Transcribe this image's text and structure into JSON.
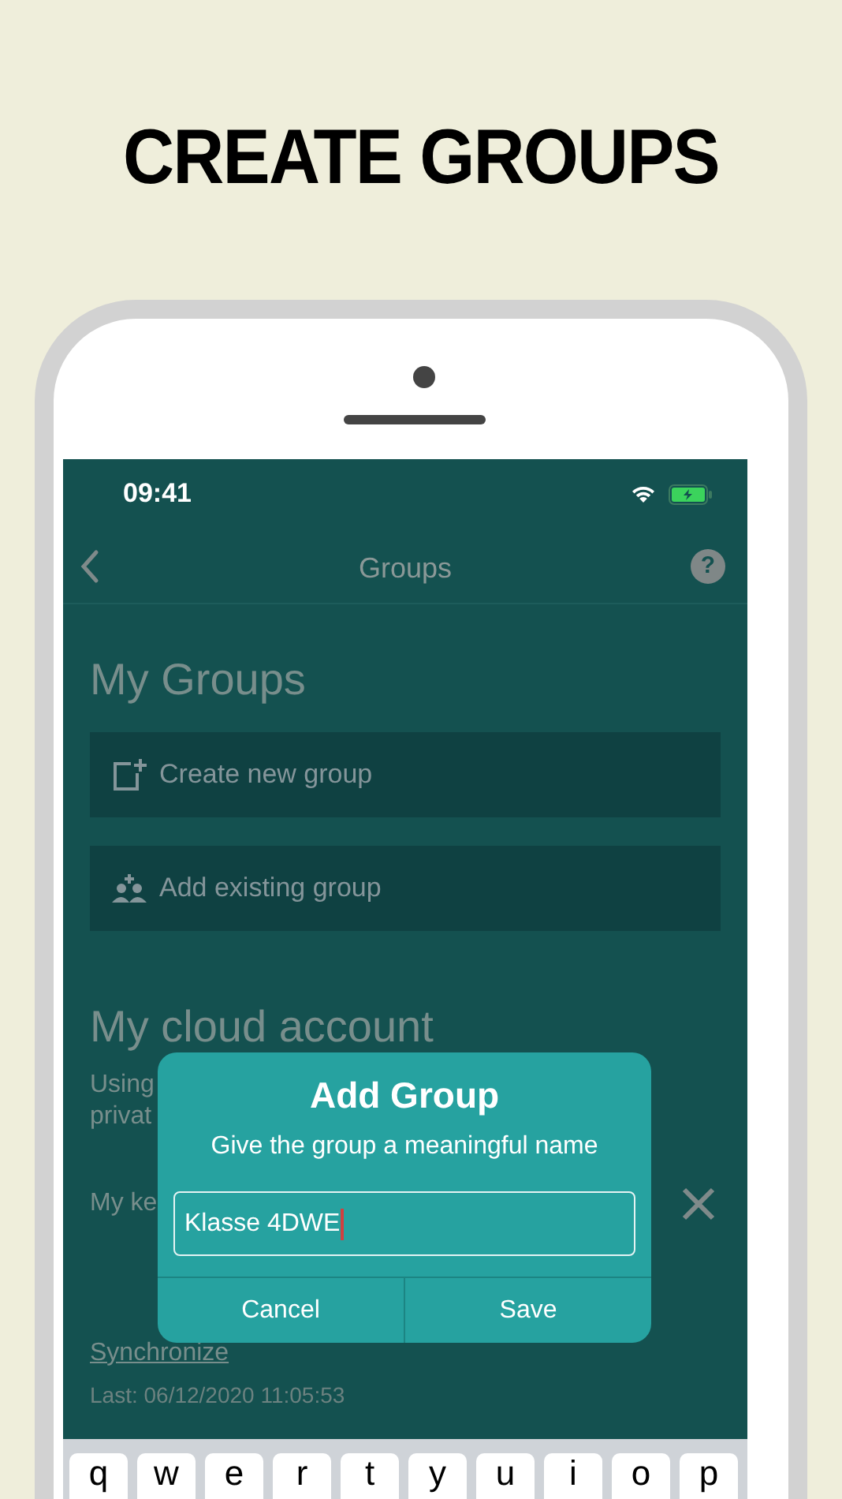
{
  "headline": "CREATE GROUPS",
  "status_bar": {
    "time": "09:41"
  },
  "nav": {
    "title": "Groups",
    "help_glyph": "?"
  },
  "groups_section": {
    "title": "My Groups",
    "actions": [
      {
        "label": "Create new group",
        "kind": "new-item"
      },
      {
        "label": "Add existing group",
        "kind": "people"
      }
    ]
  },
  "cloud_section": {
    "title": "My cloud account",
    "description_lines": [
      "Using",
      "privat"
    ],
    "key_label": "My ke",
    "sync_link": "Synchronize",
    "last_sync": "Last: 06/12/2020 11:05:53"
  },
  "dialog": {
    "title": "Add Group",
    "message": "Give the group a meaningful name",
    "input_value": "Klasse 4DWE",
    "buttons": [
      "Cancel",
      "Save"
    ]
  },
  "keyboard": {
    "keys": [
      "q",
      "w",
      "e",
      "r",
      "t",
      "y",
      "u",
      "i",
      "o",
      "p"
    ]
  }
}
